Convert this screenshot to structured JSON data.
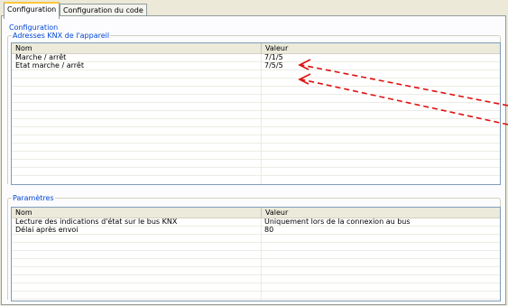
{
  "tabs": [
    {
      "label": "Configuration",
      "active": true
    },
    {
      "label": "Configuration du code",
      "active": false
    }
  ],
  "section_title": "Configuration",
  "knx_group": {
    "legend": "Adresses KNX de l'appareil",
    "columns": [
      "Nom",
      "Valeur"
    ],
    "rows": [
      {
        "name": "Marche / arrêt",
        "value": "7/1/5"
      },
      {
        "name": "Etat marche / arrêt",
        "value": "7/5/5"
      }
    ]
  },
  "params_group": {
    "legend": "Paramètres",
    "columns": [
      "Nom",
      "Valeur"
    ],
    "rows": [
      {
        "name": "Lecture des indications d'état sur le bus KNX",
        "value": "Uniquement lors de la connexion au bus"
      },
      {
        "name": "Délai après envoi",
        "value": "80"
      }
    ]
  },
  "colors": {
    "annotation_arrow": "#e01010",
    "group_title": "#0046d5",
    "active_tab_accent": "#ffc83c"
  }
}
